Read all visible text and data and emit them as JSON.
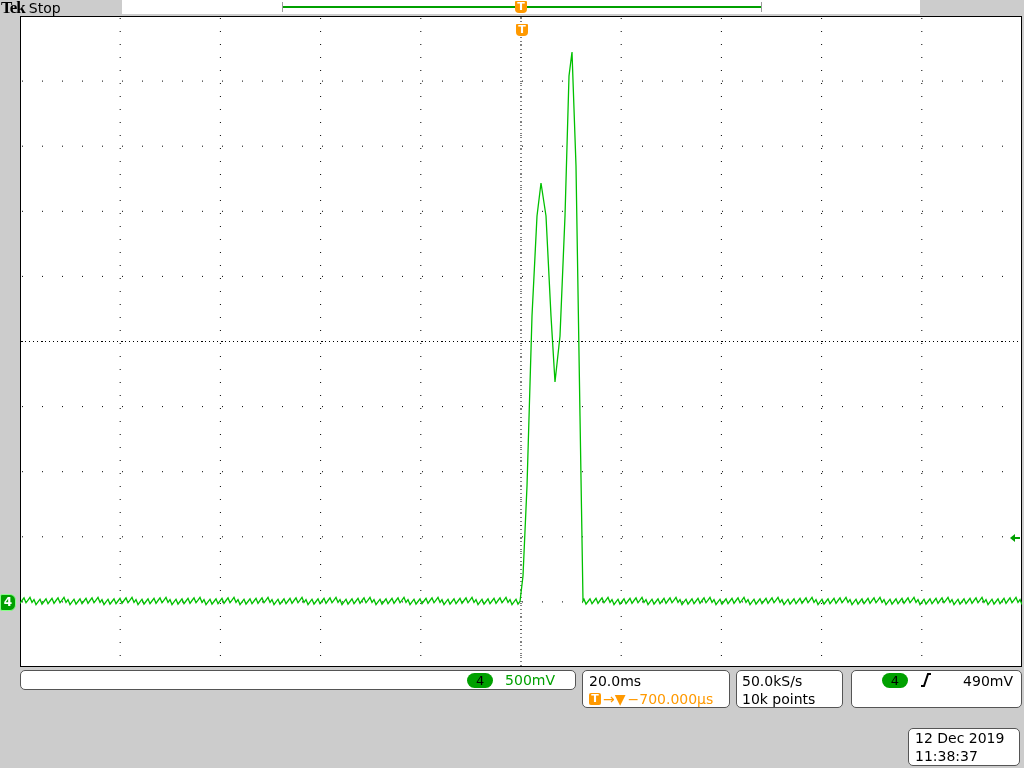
{
  "header": {
    "brand": "Tek",
    "status": "Stop",
    "trigger_marker": "T"
  },
  "graticule": {
    "trigger_marker": "T",
    "channel_marker": "4"
  },
  "vertical": {
    "channel": "4",
    "scale": "500mV"
  },
  "horizontal": {
    "timebase": "20.0ms",
    "trigger_marker": "T",
    "arrows": "→▼",
    "delay": "−700.000µs"
  },
  "acquisition": {
    "sample_rate": "50.0kS/s",
    "record_length": "10k points"
  },
  "trigger": {
    "source": "4",
    "level": "490mV"
  },
  "timestamp": {
    "date": "12 Dec 2019",
    "time": "11:38:37"
  }
}
